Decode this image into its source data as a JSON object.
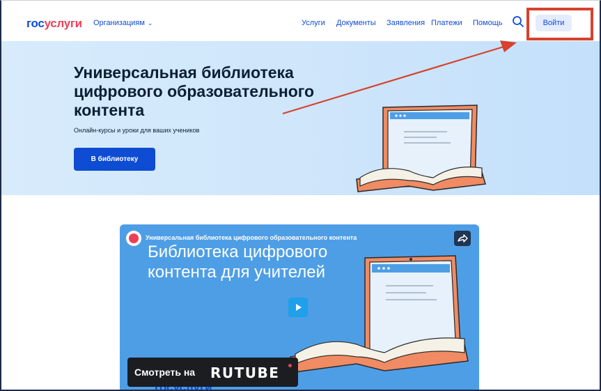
{
  "header": {
    "logo_part1": "гос",
    "logo_part2": "услуги",
    "org_label": "Организациям",
    "nav": [
      "Услуги",
      "Документы",
      "Заявления",
      "Платежи",
      "Помощь"
    ],
    "login_label": "Войти"
  },
  "hero": {
    "title": "Универсальная библиотека цифрового образовательного контента",
    "subtitle": "Онлайн-курсы и уроки для ваших учеников",
    "button_label": "В библиотеку"
  },
  "video": {
    "caption": "Универсальная библиотека цифрового образовательного контента",
    "headline": "Библиотека цифрового контента для учителей",
    "logo_text": "госуслуги",
    "watch_label": "Смотреть на",
    "platform": "RUTUBE"
  },
  "colors": {
    "brand_blue": "#0d4cd3",
    "brand_red": "#ee3f58",
    "annotation_red": "#d6422e",
    "hero_bg": "#cfe6fb",
    "video_bg": "#4e9ee6"
  },
  "icons": {
    "search": "search-icon",
    "chevron": "chevron-down-icon",
    "share": "share-icon",
    "play": "play-icon",
    "laptop": "book-laptop-illustration"
  }
}
